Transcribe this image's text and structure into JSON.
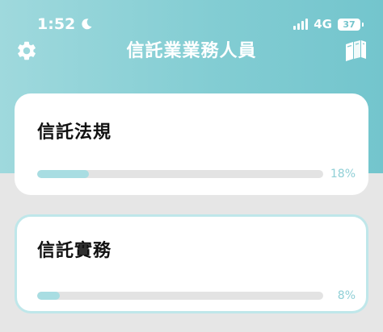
{
  "status_bar": {
    "time": "1:52",
    "network": "4G",
    "battery": "37"
  },
  "header": {
    "title": "信託業業務人員",
    "left_icon": "gear-icon",
    "right_icon": "books-icon"
  },
  "courses": [
    {
      "title": "信託法規",
      "progress": 0.18,
      "progress_label": "18%"
    },
    {
      "title": "信託實務",
      "progress": 0.08,
      "progress_label": "8%"
    }
  ],
  "colors": {
    "header_start": "#9fd9dd",
    "header_end": "#73c5cd",
    "progress_fill": "#a8dde2",
    "progress_text": "#8fcfd6",
    "selected_border": "#bfe7ea"
  }
}
